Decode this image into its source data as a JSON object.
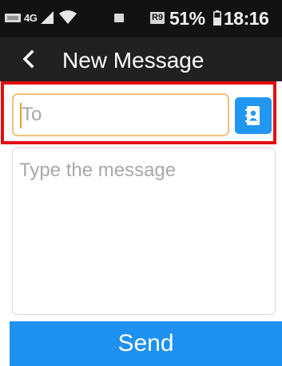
{
  "status_bar": {
    "network_type": "4G",
    "badge": "R9",
    "battery_percent": "51%",
    "time": "18:16",
    "icons": [
      "sim-icon",
      "signal-icon",
      "wifi-icon",
      "message-notification-icon",
      "battery-icon"
    ]
  },
  "app_bar": {
    "back_icon": "chevron-left-icon",
    "title": "New Message"
  },
  "compose": {
    "to_placeholder": "To",
    "to_value": "",
    "contacts_icon": "contacts-book-icon",
    "message_placeholder": "Type the message",
    "message_value": ""
  },
  "actions": {
    "send_label": "Send"
  },
  "colors": {
    "status_bar_bg": "#121212",
    "app_bar_bg": "#212121",
    "accent_blue": "#2196f3",
    "send_blue": "#1e90f0",
    "focus_border": "#f0c27a",
    "highlight_red": "#e21010"
  }
}
